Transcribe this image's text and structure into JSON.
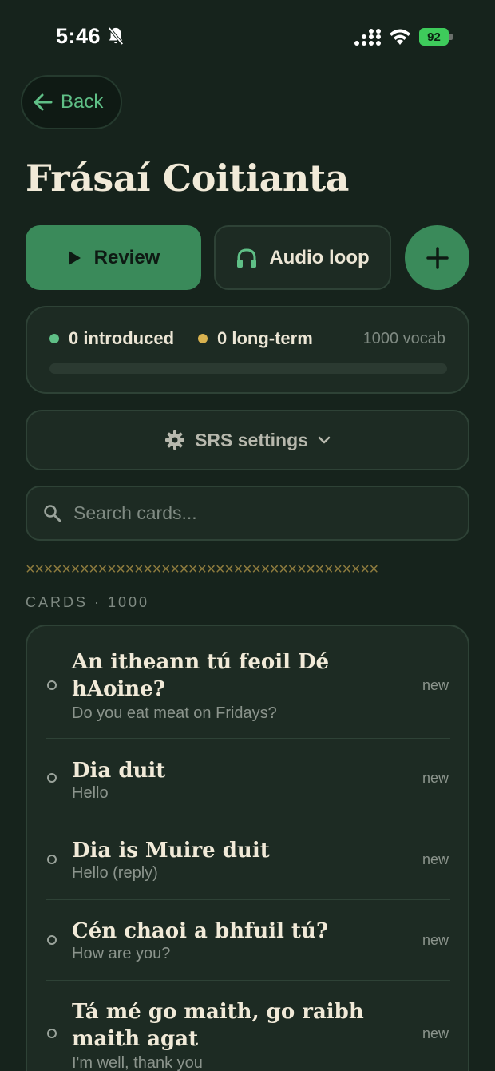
{
  "status_bar": {
    "time": "5:46",
    "battery": "92"
  },
  "nav": {
    "back_label": "Back"
  },
  "page": {
    "title": "Frásaí Coitianta"
  },
  "actions": {
    "review_label": "Review",
    "audio_label": "Audio loop"
  },
  "stats": {
    "introduced": "0 introduced",
    "long_term": "0 long-term",
    "vocab": "1000 vocab",
    "progress_fraction": 0,
    "introduced_color": "#5fbf86",
    "long_term_color": "#d9b24f"
  },
  "srs": {
    "label": "SRS settings"
  },
  "search": {
    "placeholder": "Search cards..."
  },
  "section": {
    "divider_glyphs": "×××××××××××××××××××××××××××××××××××××××",
    "heading": "CARDS · 1000"
  },
  "cards": [
    {
      "term": "An itheann tú feoil Dé hAoine?",
      "translation": "Do you eat meat on Fridays?",
      "status": "new"
    },
    {
      "term": "Dia duit",
      "translation": "Hello",
      "status": "new"
    },
    {
      "term": "Dia is Muire duit",
      "translation": "Hello (reply)",
      "status": "new"
    },
    {
      "term": "Cén chaoi a bhfuil tú?",
      "translation": "How are you?",
      "status": "new"
    },
    {
      "term": "Tá mé go maith, go raibh maith agat",
      "translation": "I'm well, thank you",
      "status": "new"
    }
  ],
  "colors": {
    "accent": "#3a8a5a",
    "background": "#16231c",
    "panel": "#1d2b23"
  }
}
